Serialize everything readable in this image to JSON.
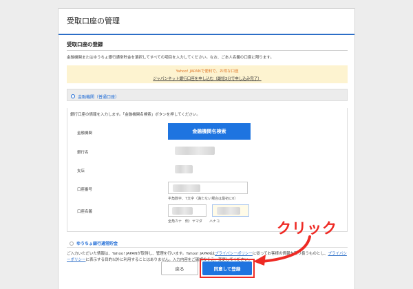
{
  "page": {
    "title": "受取口座の管理"
  },
  "section": {
    "title": "受取口座の登録",
    "intro": "金融機関またはゆうちょ銀行通常貯金を選択してすべての項目を入力してください。なお、ご本人名義の口座に限ります。"
  },
  "notice": {
    "line1": "Yahoo! JAPANで便利で、お得な口座",
    "line2": "ジャパンネット銀行口座を申し込む（最短3分で申し込み完了）"
  },
  "bank_option": {
    "label": "金融機関（普通口座）"
  },
  "form": {
    "intro": "銀行口座の情報を入力します。「金融機関名検索」ボタンを押してください。",
    "bank_label": "金融機関",
    "search_button": "金融機関名検索",
    "bank_name_label": "銀行名",
    "branch_label": "支店",
    "account_number_label": "口座番号",
    "account_number_hint": "半角数字、7文字（満たない場合は最初に0）",
    "account_name_label": "口座名義",
    "account_name_hint": "全角カナ　例：ヤマダ　　ハナコ"
  },
  "yucho_option": {
    "label": "ゆうちょ銀行通常貯金"
  },
  "privacy": {
    "part1": "ご入力いただいた情報は、Yahoo! JAPANが取得し、管理を行います。Yahoo! JAPANは",
    "link1": "プライバシーポリシー",
    "part2": "に従ってお客様の情報を取り扱うものとし、",
    "link2": "プライバシーポリシー",
    "part3": "に表示する目的以外に利用することはありません。入力内容をご確認のうえ、変更してください。"
  },
  "buttons": {
    "back": "戻る",
    "submit": "同意して登録"
  },
  "annotation": {
    "text": "クリック",
    "color": "#ee2a24"
  },
  "colors": {
    "accent": "#1e74e0",
    "notice_bg": "#fdf3d0",
    "notice_text": "#e0792a"
  }
}
